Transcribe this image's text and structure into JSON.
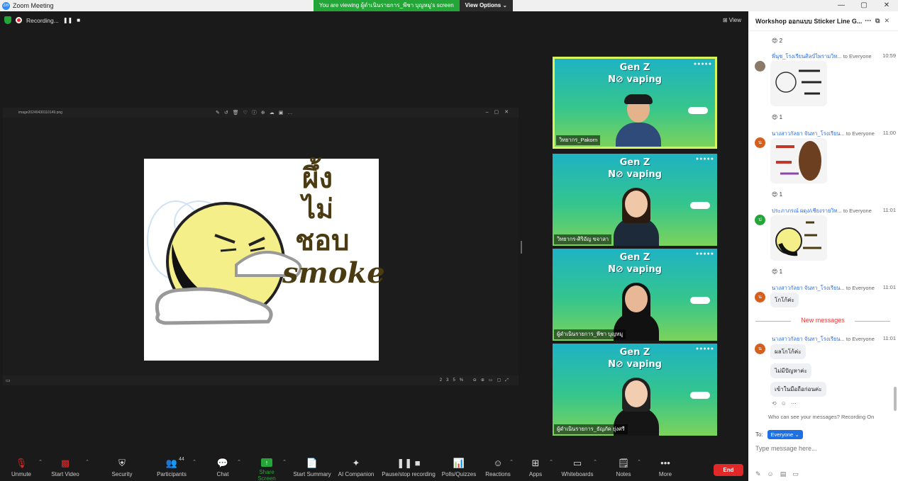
{
  "window": {
    "title": "Zoom Meeting",
    "controls": [
      "—",
      "▢",
      "✕"
    ]
  },
  "banner": {
    "viewing": "You are viewing ผู้ดำเนินรายการ_พีชา บุญหมู's screen",
    "options": "View Options ⌄"
  },
  "status": {
    "recording": "Recording...",
    "pause": "❚❚",
    "stop": "■",
    "view": "⊞ View"
  },
  "share": {
    "filename": "image20240430110149.png",
    "zoom_pct": "235%",
    "sticker_text": {
      "line1": "ผึ้ง",
      "line2": "ไม่",
      "line3": "ชอบ",
      "line4": "smoke"
    }
  },
  "gallery": {
    "heading1": "Gen Z",
    "heading2": "N⊘ vaping",
    "tiles": [
      {
        "name": "วิทยากร_Pakorn"
      },
      {
        "name": "วิทยากร-ศิริอัญ ขจาลา"
      },
      {
        "name": "ผู้ดำเนินรายการ_พีชา บุญหมู"
      },
      {
        "name": "ผู้ดำเนินรายการ_ธัญภัค ยุ่งศรี"
      }
    ]
  },
  "toolbar": {
    "unmute": "Unmute",
    "start_video": "Start Video",
    "security": "Security",
    "participants": "Participants",
    "participants_count": "44",
    "chat": "Chat",
    "share_screen": "Share Screen",
    "start_summary": "Start Summary",
    "ai_companion": "AI Companion",
    "pause_stop_recording": "Pause/stop recording",
    "polls": "Polls/Quizzes",
    "reactions": "Reactions",
    "apps": "Apps",
    "whiteboards": "Whiteboards",
    "notes": "Notes",
    "more": "More",
    "end": "End"
  },
  "chat": {
    "title": "Workshop ออกแบบ Sticker Line G...",
    "to_everyone": "to Everyone",
    "messages": [
      {
        "reaction": "😍 2"
      },
      {
        "sender": "พี่นุช_โรงเรียนศิลป์ไพรามวิท...",
        "time": "10:59",
        "reaction": "😍 1",
        "avatar": ""
      },
      {
        "sender": "นางสาวกัลยา จันทา_โรงเรียน...",
        "time": "11:00",
        "reaction": "😍 1",
        "avatar": "น"
      },
      {
        "sender": "ประภาภรณ์ ผดุง/เชียงรายวิท...",
        "time": "11:01",
        "reaction": "😍 1",
        "avatar": "ป"
      },
      {
        "sender": "นางสาวกัลยา จันทา_โรงเรียน...",
        "time": "11:01",
        "avatar": "น",
        "text": "โกโก้ค่ะ"
      }
    ],
    "new_messages": "New messages",
    "latest": {
      "sender": "นางสาวกัลยา จันทา_โรงเรียน...",
      "time": "11:01",
      "avatar": "น",
      "lines": [
        "ผลโกโก้ค่ะ",
        "ไม่มีปัญหาค่ะ",
        "เข้าในมือถือก่อนค่ะ"
      ]
    },
    "who_can_see": "Who can see your messages? Recording On",
    "to_label": "To:",
    "to_value": "Everyone ⌄",
    "placeholder": "Type message here..."
  }
}
